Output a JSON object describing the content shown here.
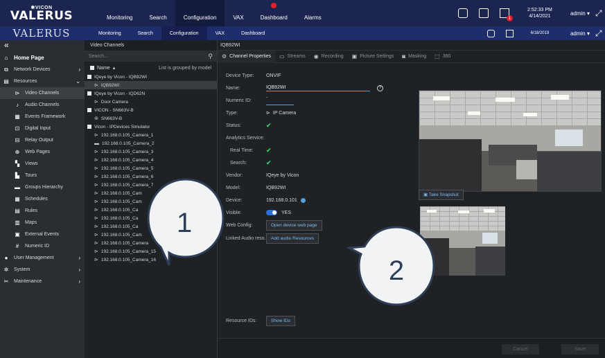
{
  "app": {
    "brand_sub": "VICON",
    "brand_main": "VALERUS",
    "ghost_brand": "VALERUS"
  },
  "topnav": [
    {
      "label": "Monitoring"
    },
    {
      "label": "Search"
    },
    {
      "label": "Configuration",
      "active": true
    },
    {
      "label": "VAX"
    },
    {
      "label": "Dashboard"
    },
    {
      "label": "Alarms"
    }
  ],
  "ghostnav": [
    {
      "label": "Monitoring"
    },
    {
      "label": "Search"
    },
    {
      "label": "Configuration",
      "active": true
    },
    {
      "label": "VAX"
    },
    {
      "label": "Dashboard"
    }
  ],
  "topright": {
    "time": "2:52:33 PM",
    "date": "4/14/2021",
    "ghost_date": "6/18/2019",
    "user": "admin",
    "ghost_user": "admin",
    "flag_count": "1"
  },
  "sidebar": {
    "collapse": "«",
    "items": [
      {
        "label": "Home Page",
        "icon": "home-icon"
      },
      {
        "label": "Network Devices",
        "icon": "network-icon",
        "chevron": "›"
      },
      {
        "label": "Resources",
        "icon": "resources-icon",
        "chevron": "⌄"
      },
      {
        "label": "Video Channels",
        "icon": "camera-icon",
        "sub": true,
        "selected": true
      },
      {
        "label": "Audio Channels",
        "icon": "audio-icon",
        "sub": true
      },
      {
        "label": "Events Framework",
        "icon": "events-icon",
        "sub": true
      },
      {
        "label": "Digital Input",
        "icon": "digital-input-icon",
        "sub": true
      },
      {
        "label": "Relay Output",
        "icon": "relay-icon",
        "sub": true
      },
      {
        "label": "Web Pages",
        "icon": "web-icon",
        "sub": true
      },
      {
        "label": "Views",
        "icon": "views-icon",
        "sub": true
      },
      {
        "label": "Tours",
        "icon": "tours-icon",
        "sub": true
      },
      {
        "label": "Groups Hierarchy",
        "icon": "folder-icon",
        "sub": true
      },
      {
        "label": "Schedules",
        "icon": "calendar-icon",
        "sub": true
      },
      {
        "label": "Rules",
        "icon": "rules-icon",
        "sub": true
      },
      {
        "label": "Maps",
        "icon": "map-icon",
        "sub": true
      },
      {
        "label": "External Events",
        "icon": "external-events-icon",
        "sub": true
      },
      {
        "label": "Numeric ID",
        "icon": "numeric-id-icon",
        "sub": true
      },
      {
        "label": "User Management",
        "icon": "user-icon",
        "chevron": "›"
      },
      {
        "label": "System",
        "icon": "system-icon",
        "chevron": "›"
      },
      {
        "label": "Maintenance",
        "icon": "tools-icon",
        "chevron": "›"
      }
    ]
  },
  "tree": {
    "title": "Video Channels",
    "search_placeholder": "Search...",
    "header_name": "Name",
    "header_group": "List is grouped by model",
    "rows": [
      {
        "label": "IQeye by Vicon - IQB92WI",
        "level": 0,
        "kind": "group"
      },
      {
        "label": "IQB92WI",
        "level": 1,
        "kind": "cam",
        "selected": true
      },
      {
        "label": "IQeye by Vicon - IQD62N",
        "level": 0,
        "kind": "group"
      },
      {
        "label": "Door Camera",
        "level": 1,
        "kind": "cam"
      },
      {
        "label": "VICON - SN663V-B",
        "level": 0,
        "kind": "group"
      },
      {
        "label": "SN663V-B",
        "level": 1,
        "kind": "dome"
      },
      {
        "label": "Vicon - IPDevices Simulator",
        "level": 0,
        "kind": "group"
      },
      {
        "label": "192.168.0.105_Camera_1",
        "level": 1,
        "kind": "cam"
      },
      {
        "label": "192.168.0.105_Camera_2",
        "level": 1,
        "kind": "box"
      },
      {
        "label": "192.168.0.105_Camera_3",
        "level": 1,
        "kind": "cam"
      },
      {
        "label": "192.168.0.105_Camera_4",
        "level": 1,
        "kind": "cam"
      },
      {
        "label": "192.168.0.105_Camera_5",
        "level": 1,
        "kind": "cam"
      },
      {
        "label": "192.168.0.105_Camera_6",
        "level": 1,
        "kind": "cam"
      },
      {
        "label": "192.168.0.105_Camera_7",
        "level": 1,
        "kind": "cam"
      },
      {
        "label": "192.168.0.105_Cam",
        "level": 1,
        "kind": "cam"
      },
      {
        "label": "192.168.0.105_Cam",
        "level": 1,
        "kind": "cam"
      },
      {
        "label": "192.168.0.105_Ca",
        "level": 1,
        "kind": "cam"
      },
      {
        "label": "192.168.0.105_Ca",
        "level": 1,
        "kind": "cam"
      },
      {
        "label": "192.168.0.105_Ca",
        "level": 1,
        "kind": "cam"
      },
      {
        "label": "192.168.0.105_Cam",
        "level": 1,
        "kind": "cam"
      },
      {
        "label": "192.168.0.105_Camera",
        "level": 1,
        "kind": "cam"
      },
      {
        "label": "192.168.0.105_Camera_15",
        "level": 1,
        "kind": "cam"
      },
      {
        "label": "192.168.0.105_Camera_16",
        "level": 1,
        "kind": "cam"
      }
    ]
  },
  "main": {
    "crumb": "IQB92WI",
    "tabs": [
      {
        "label": "Channel Properties",
        "icon": "properties-icon",
        "glyph": "⚙",
        "active": true
      },
      {
        "label": "Streams",
        "icon": "streams-icon",
        "glyph": "▭"
      },
      {
        "label": "Recording",
        "icon": "recording-icon",
        "glyph": "◉"
      },
      {
        "label": "Picture Settings",
        "icon": "picture-icon",
        "glyph": "▣"
      },
      {
        "label": "Masking",
        "icon": "masking-icon",
        "glyph": "◙"
      },
      {
        "label": "360",
        "icon": "panorama-icon",
        "glyph": "⬚"
      }
    ],
    "props": {
      "device_type_label": "Device Type:",
      "device_type": "ONVIF",
      "name_label": "Name:",
      "name": "IQB92WI",
      "help": "?",
      "numeric_label": "Numeric ID:",
      "numeric_value": "-",
      "type_label": "Type:",
      "type": "IP Camera",
      "status_label": "Status:",
      "analytics_label": "Analytics Service:",
      "realtime_label": "Real Time:",
      "search_label": "Search:",
      "vendor_label": "Vendor:",
      "vendor": "IQeye by Vicon",
      "model_label": "Model:",
      "model": "IQB92WI",
      "device_label": "Device:",
      "device": "192.168.0.101",
      "visible_label": "Visible:",
      "visible": "YES",
      "webconfig_label": "Web Config:",
      "webconfig_btn": "Open device web page",
      "linked_label": "Linked Audio reso...:",
      "linked_btn": "Add audio Resources",
      "resource_label": "Resource IDs:",
      "resource_btn": "Show IDs",
      "checkmark": "✔"
    },
    "snapshot_btn": "Take Snapshot",
    "cancel": "Cancel",
    "save": "Save"
  },
  "callouts": [
    {
      "label": "1"
    },
    {
      "label": "2"
    }
  ],
  "colors": {
    "topbar": "#1b2550",
    "accent": "#4ea1e6",
    "check": "#39c46b",
    "alert": "#e0212c"
  }
}
